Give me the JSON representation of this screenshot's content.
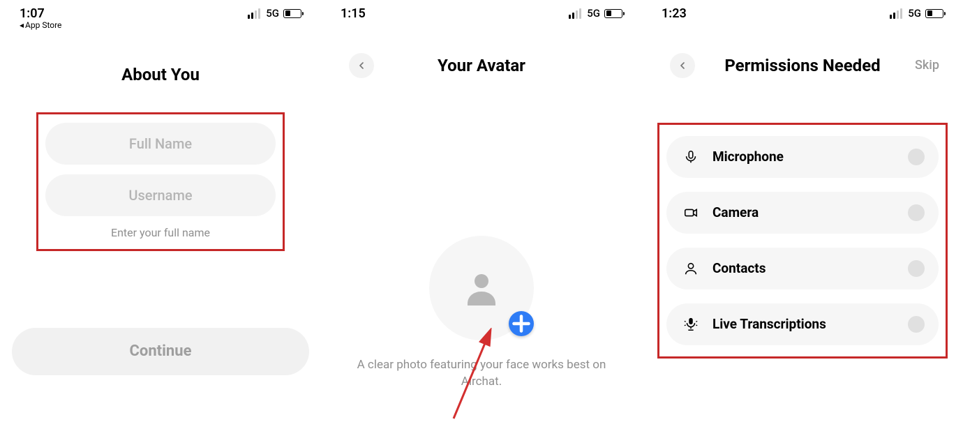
{
  "screens": [
    {
      "status": {
        "time": "1:07",
        "back_app": "App Store",
        "network": "5G"
      },
      "title": "About You",
      "fields": [
        {
          "placeholder": "Full Name"
        },
        {
          "placeholder": "Username"
        }
      ],
      "hint": "Enter your full name",
      "continue_label": "Continue"
    },
    {
      "status": {
        "time": "1:15",
        "network": "5G"
      },
      "title": "Your Avatar",
      "caption": "A clear photo featuring your face works best on Airchat."
    },
    {
      "status": {
        "time": "1:23",
        "network": "5G"
      },
      "title": "Permissions Needed",
      "skip": "Skip",
      "permissions": [
        {
          "name": "Microphone"
        },
        {
          "name": "Camera"
        },
        {
          "name": "Contacts"
        },
        {
          "name": "Live Transcriptions"
        }
      ]
    }
  ]
}
